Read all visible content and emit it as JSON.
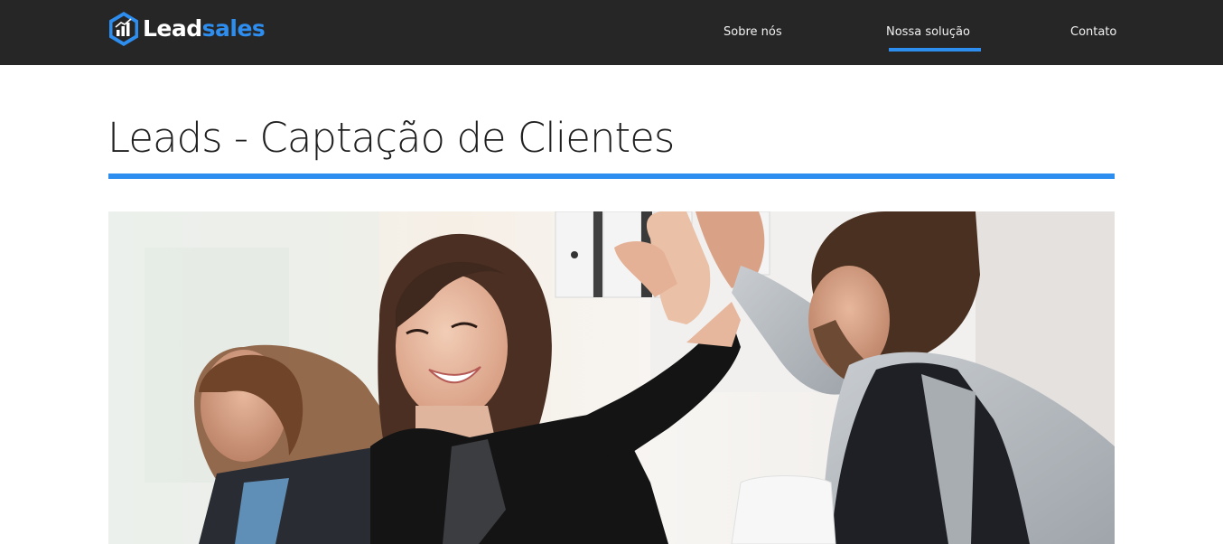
{
  "brand": {
    "name_part1": "Lead",
    "name_part2": "sales",
    "accent_color": "#2e8ef0",
    "header_bg": "#262626",
    "logo_icon": "hexagon-chart-icon"
  },
  "nav": {
    "items": [
      {
        "label": "Sobre nós",
        "active": false
      },
      {
        "label": "Nossa solução",
        "active": true
      },
      {
        "label": "Contato",
        "active": false
      }
    ]
  },
  "page": {
    "title": "Leads - Captação de Clientes"
  },
  "hero_image": {
    "kind": "photo"
  }
}
